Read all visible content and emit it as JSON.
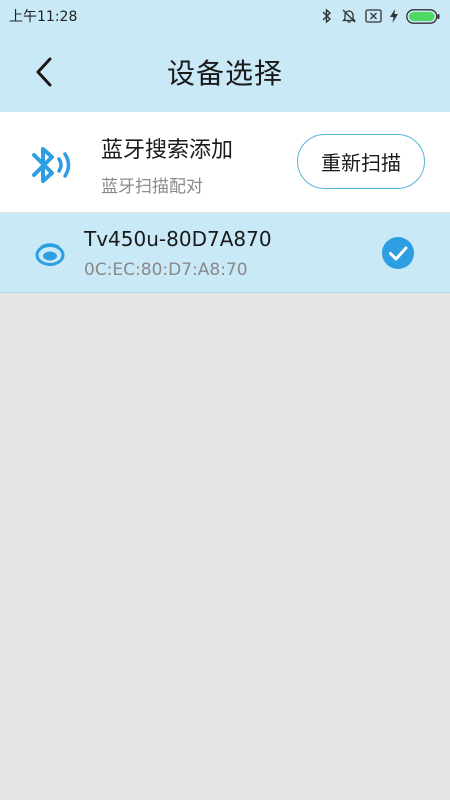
{
  "status_bar": {
    "time": "上午11:28",
    "icons": [
      "bluetooth-icon",
      "silent-bell-icon",
      "sim-blocked-icon",
      "charging-icon",
      "battery-icon"
    ],
    "battery_color": "#4cd964"
  },
  "header": {
    "title": "设备选择",
    "back_icon": "chevron-left-icon"
  },
  "bluetooth_section": {
    "icon": "bluetooth-search-icon",
    "title": "蓝牙搜索添加",
    "subtitle": "蓝牙扫描配对",
    "rescan_label": "重新扫描"
  },
  "devices": [
    {
      "name": "Tv450u-80D7A870",
      "mac": "0C:EC:80:D7:A8:70",
      "icon": "printer-device-icon",
      "selected": true
    }
  ],
  "colors": {
    "header_bg": "#c8e9f5",
    "accent": "#2e9ee3",
    "page_bg": "#e6e6e6"
  }
}
